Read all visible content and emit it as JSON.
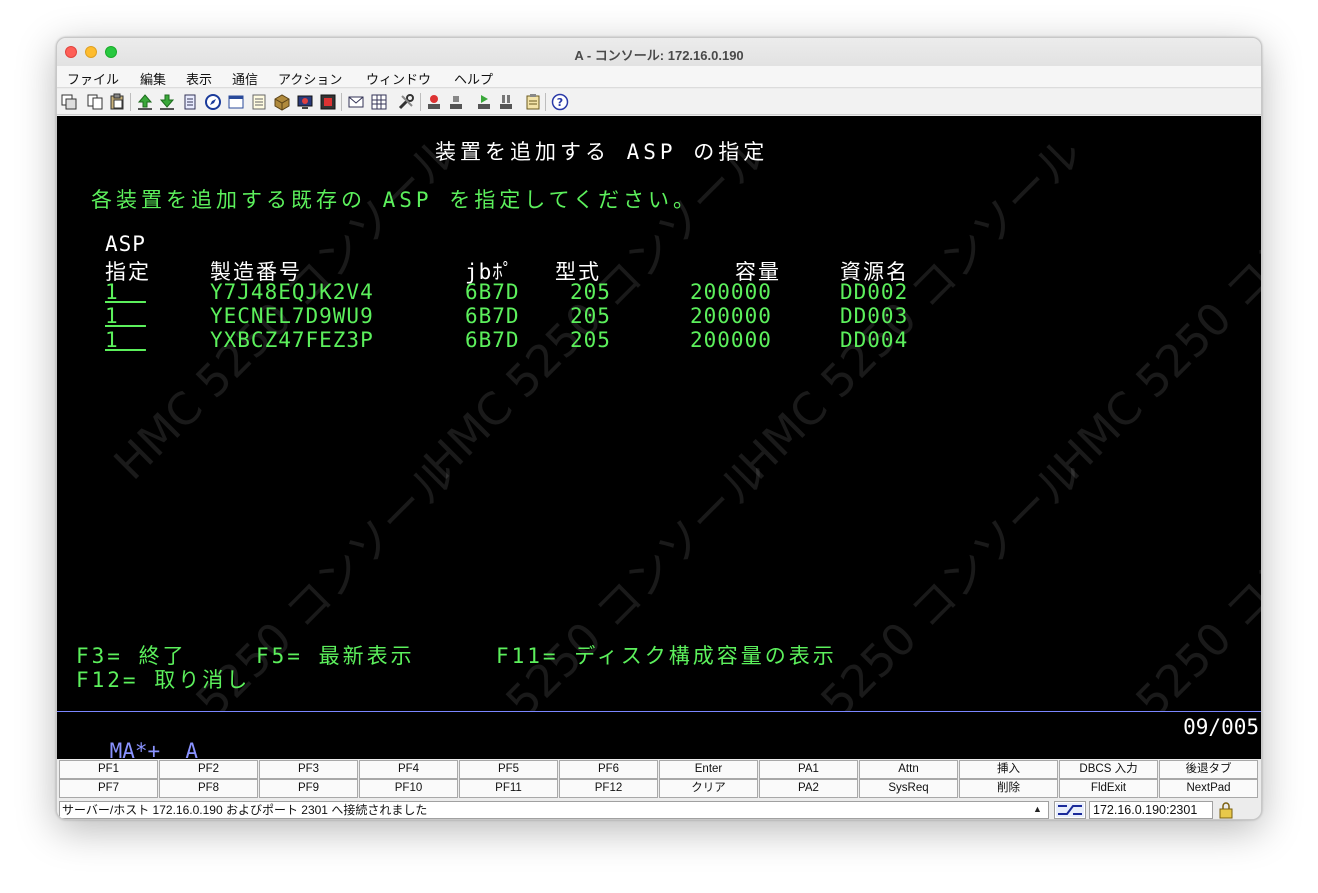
{
  "window": {
    "title": "A - コンソール: 172.16.0.190"
  },
  "menu": [
    "ファイル",
    "編集",
    "表示",
    "通信",
    "アクション",
    "ウィンドウ",
    "ヘルプ"
  ],
  "toolbar_icons": [
    "copy-screen-icon",
    "copy-icon",
    "paste-icon",
    "upload-icon",
    "download-icon",
    "print-icon",
    "navigator-icon",
    "window-icon",
    "notes-icon",
    "package-icon",
    "display-icon",
    "film-icon",
    "mail-icon",
    "grid-icon",
    "wrench-icon",
    "macro-record-icon",
    "macro-stop-icon",
    "macro-play-icon",
    "macro-pause-icon",
    "clipboard-icon",
    "help-icon"
  ],
  "screen": {
    "title": "装置を追加する ASP の指定",
    "instruction": "各装置を追加する既存の ASP を指定してください。",
    "col_asp_top": "ASP",
    "col_asp": "指定",
    "col_serial": "製造番号",
    "col_type": "jbﾎﾟ",
    "col_model": "型式",
    "col_capacity": "容量",
    "col_resource": "資源名",
    "rows": [
      {
        "asp": "1  ",
        "serial": "Y7J48EQJK2V4",
        "type": "6B7D",
        "model": "205",
        "capacity": "200000",
        "resource": "DD002"
      },
      {
        "asp": "1  ",
        "serial": "YECNEL7D9WU9",
        "type": "6B7D",
        "model": "205",
        "capacity": "200000",
        "resource": "DD003"
      },
      {
        "asp": "1  ",
        "serial": "YXBCZ47FEZ3P",
        "type": "6B7D",
        "model": "205",
        "capacity": "200000",
        "resource": "DD004"
      }
    ],
    "f3": "F3= 終了",
    "f5": "F5= 最新表示",
    "f11": "F11= ディスク構成容量の表示",
    "f12": "F12= 取り消し",
    "watermark": "HMC 5250 コンソール"
  },
  "oia": {
    "left": "MA*+  A",
    "right": "09/005"
  },
  "keys_row1": [
    "PF1",
    "PF2",
    "PF3",
    "PF4",
    "PF5",
    "PF6",
    "Enter",
    "PA1",
    "Attn",
    "挿入",
    "DBCS 入力",
    "後退タブ"
  ],
  "keys_row2": [
    "PF7",
    "PF8",
    "PF9",
    "PF10",
    "PF11",
    "PF12",
    "クリア",
    "PA2",
    "SysReq",
    "削除",
    "FldExit",
    "NextPad"
  ],
  "status": {
    "message": "サーバー/ホスト 172.16.0.190 およびポート 2301 へ接続されました",
    "host": "172.16.0.190:2301"
  }
}
